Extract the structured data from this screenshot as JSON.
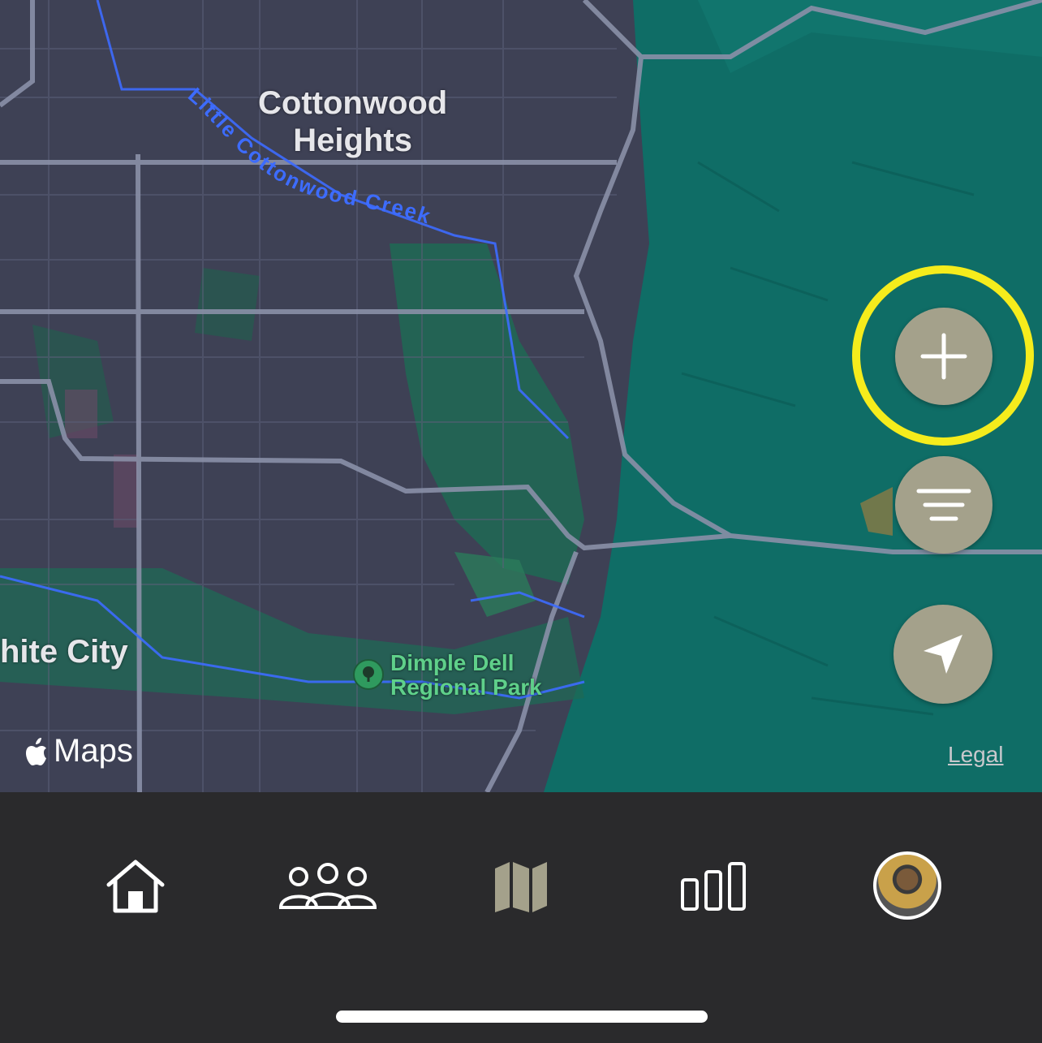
{
  "map": {
    "labels": {
      "city_1": "Cottonwood\nHeights",
      "city_2": "hite City",
      "creek": "Little Cottonwood Creek",
      "park": "Dimple Dell\nRegional Park"
    },
    "attribution": "Maps",
    "legal": "Legal",
    "colors": {
      "urban": "#3e4155",
      "mountain": "#0f6d66",
      "park": "#1f6a55",
      "water": "#3d6cff",
      "road": "#8a90a8"
    }
  },
  "controls": {
    "add_icon": "plus-icon",
    "filter_icon": "filter-lines-icon",
    "locate_icon": "location-arrow-icon",
    "highlight_color": "#f5ec1c",
    "button_color": "#a4a18b"
  },
  "tabbar": {
    "tabs": [
      {
        "id": "home",
        "icon": "home-icon"
      },
      {
        "id": "friends",
        "icon": "people-icon"
      },
      {
        "id": "map",
        "icon": "map-icon",
        "active": true
      },
      {
        "id": "stats",
        "icon": "bar-chart-icon"
      },
      {
        "id": "profile",
        "icon": "avatar"
      }
    ]
  }
}
